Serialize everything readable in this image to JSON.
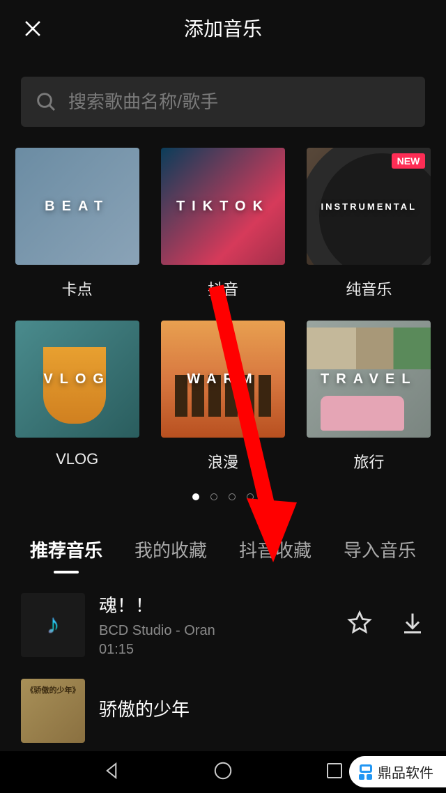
{
  "header": {
    "title": "添加音乐"
  },
  "search": {
    "placeholder": "搜索歌曲名称/歌手"
  },
  "categories": [
    {
      "overlay": "BEAT",
      "label": "卡点",
      "bg": "bg-beat",
      "badge": ""
    },
    {
      "overlay": "TIKTOK",
      "label": "抖音",
      "bg": "bg-tiktok",
      "badge": ""
    },
    {
      "overlay": "INSTRUMENTAL",
      "label": "纯音乐",
      "bg": "bg-instrumental",
      "badge": "NEW"
    },
    {
      "overlay": "VLOG",
      "label": "VLOG",
      "bg": "bg-vlog",
      "badge": ""
    },
    {
      "overlay": "WARM",
      "label": "浪漫",
      "bg": "bg-warm",
      "badge": ""
    },
    {
      "overlay": "TRAVEL",
      "label": "旅行",
      "bg": "bg-travel",
      "badge": ""
    }
  ],
  "pagination": {
    "total": 4,
    "active": 0
  },
  "tabs": [
    {
      "label": "推荐音乐",
      "active": true
    },
    {
      "label": "我的收藏",
      "active": false
    },
    {
      "label": "抖音收藏",
      "active": false
    },
    {
      "label": "导入音乐",
      "active": false
    }
  ],
  "songs": [
    {
      "title": "魂！！",
      "artist": "BCD Studio - Oran",
      "duration": "01:15",
      "cover": "cover1",
      "coverText": ""
    },
    {
      "title": "骄傲的少年",
      "artist": "",
      "duration": "",
      "cover": "cover2",
      "coverText": "《骄傲的少年》"
    }
  ],
  "watermark": {
    "text": "鼎品软件"
  }
}
